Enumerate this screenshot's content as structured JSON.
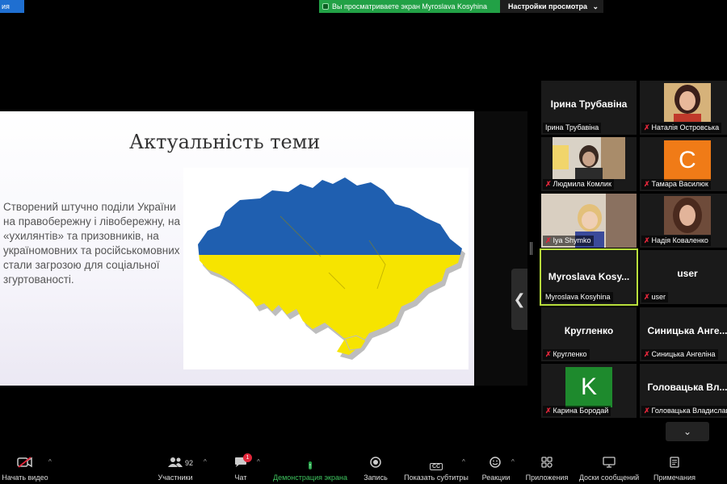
{
  "top": {
    "left_fragment": "ия",
    "viewing_text": "Вы просматриваете экран Myroslava  Kosyhina",
    "view_options_label": "Настройки просмотра",
    "view_options_caret": "⌄"
  },
  "slide": {
    "title": "Актуальність теми",
    "body": "Створений штучно поділи України на правобережну і лівобережну, на «ухилянтів» та призовників, на україномовних та російськомовних стали загрозою для соціальної згуртованості.",
    "map_colors": {
      "top": "#1f5fb0",
      "bottom": "#f6e400",
      "edge": "#bdbdbd"
    }
  },
  "gallery": {
    "tiles": [
      {
        "label": "Ірина  Трубавіна",
        "big": "Ірина  Трубавіна",
        "muted": false
      },
      {
        "label": "Наталія Островська",
        "muted": true
      },
      {
        "label": "Людмила Комлик",
        "muted": true
      },
      {
        "label": "Тамара Василюк",
        "muted": true,
        "letter": "C",
        "color": "#f07b17"
      },
      {
        "label": "Iya Shymko",
        "muted": true
      },
      {
        "label": "Надія Коваленко",
        "muted": true
      },
      {
        "label": "Myroslava  Kosyhina",
        "big": "Myroslava   Kosy...",
        "muted": false,
        "active": true
      },
      {
        "label": "user",
        "big": "user",
        "muted": true
      },
      {
        "label": "Кругленко",
        "big": "Кругленко",
        "muted": true
      },
      {
        "label": "Синицька Ангеліна",
        "big": "Синицька  Анге...",
        "muted": true
      },
      {
        "label": "Карина Бородай",
        "muted": true,
        "letter": "K",
        "color": "#1e8a2d"
      },
      {
        "label": "Головацька Владислава",
        "big": "Головацька  Вл...",
        "muted": true
      }
    ],
    "scroll_down_icon": "⌄"
  },
  "toolbar": {
    "start_video": "Начать видео",
    "participants": "Участники",
    "participants_count": "92",
    "chat": "Чат",
    "chat_badge": "1",
    "share": "Демонстрация экрана",
    "record": "Запись",
    "captions": "Показать субтитры",
    "captions_icon": "CC",
    "reactions": "Реакции",
    "apps": "Приложения",
    "whiteboards": "Доски сообщений",
    "notes": "Примечания"
  }
}
